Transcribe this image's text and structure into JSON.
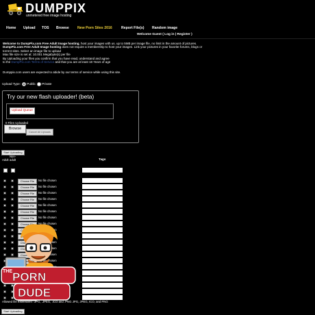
{
  "header": {
    "logo_title": "DUMPPIX",
    "tagline": "unmetered free image hosting"
  },
  "nav": {
    "items": [
      {
        "label": "Home"
      },
      {
        "label": "Upload"
      },
      {
        "label": "TOS"
      },
      {
        "label": "Browse"
      },
      {
        "label": "New Porn Sites 2016"
      },
      {
        "label": "Report File(s)"
      },
      {
        "label": "Random image"
      }
    ],
    "welcome": "Welcome Guest ( Log in | Register )"
  },
  "intro": {
    "line1_bold": "Welcome to DumpPix.com Free Adult Image hosting",
    "line1_rest": ", host your images with us. up to 5MB per image file, no limit in the amount of pictures.",
    "line2_bold": "DumpPix.com Free Adult Image hosting",
    "line2_rest": " does not require a membership to host your images. Link your pictures in your favorite forums, blogs or torrent sites. Select an image file to upload",
    "line3": "Max file size is set at: 10.001 Megabyte(s) per file",
    "line4": "By Uploading your files you confirm that you have read, understand and agree",
    "line5_pre": "to the",
    "line5_link": "DumpPix.com Terms of Service",
    "line5_post": "and that you are at least 18 Years of age",
    "rules_note": "Dumppix.com users are expected to abide by our terms of service while using this site."
  },
  "upload_type": {
    "label": "Upload Type:",
    "public": "Public",
    "private": "Private"
  },
  "flash": {
    "title": "Try our new flash uploader! (beta)",
    "queue_label": "Upload Queue",
    "files_uploaded": "0 Files Uploaded",
    "browse": "Browse",
    "cancel": "Cancel All Uploads"
  },
  "form": {
    "start_upload": "Start Uploading",
    "col_adult": "Adult",
    "col_nonadult": "Non-adult",
    "col_tags": "Tags",
    "choose_file": "Choose File",
    "no_file": "No file chosen",
    "allowed": "Allowed file extensions: .JPG, .JPEG, .ICO and .PNG JPG, JPEG, ICO, and PNG"
  },
  "mascot": {
    "text_the": "THE",
    "text_porn": "PORN",
    "text_dude": "DUDE"
  }
}
